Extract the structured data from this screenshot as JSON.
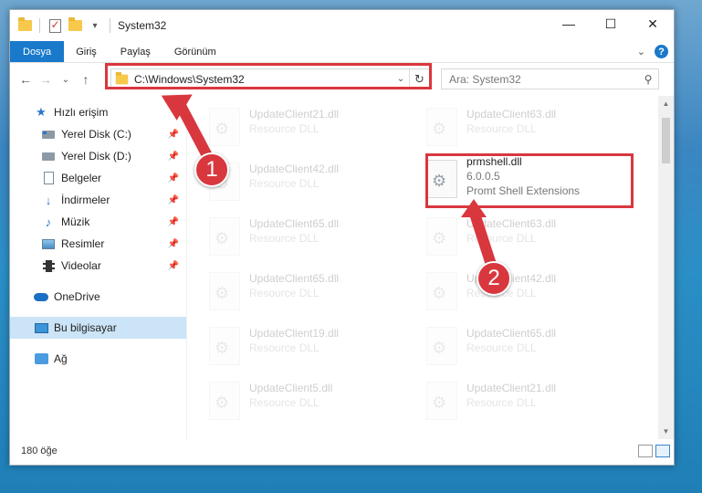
{
  "window": {
    "title": "System32",
    "controls": {
      "minimize": "—",
      "maximize": "☐",
      "close": "✕"
    }
  },
  "ribbon": {
    "tabs": [
      {
        "label": "Dosya",
        "active": true
      },
      {
        "label": "Giriş"
      },
      {
        "label": "Paylaş"
      },
      {
        "label": "Görünüm"
      }
    ],
    "expand_glyph": "⌄",
    "help_glyph": "?"
  },
  "nav": {
    "back": "←",
    "forward": "→",
    "recent": "⌄",
    "up": "↑",
    "address": "C:\\Windows\\System32",
    "address_dropdown": "⌄",
    "refresh": "↻",
    "search_placeholder": "Ara: System32",
    "search_glyph": "⚲"
  },
  "sidebar": {
    "items": [
      {
        "label": "Hızlı erişim",
        "icon": "star-icon"
      },
      {
        "label": "Yerel Disk (C:)",
        "icon": "drive-c-icon",
        "pinned": true
      },
      {
        "label": "Yerel Disk (D:)",
        "icon": "drive-d-icon",
        "pinned": true
      },
      {
        "label": "Belgeler",
        "icon": "documents-icon",
        "pinned": true
      },
      {
        "label": "İndirmeler",
        "icon": "downloads-icon",
        "pinned": true
      },
      {
        "label": "Müzik",
        "icon": "music-icon",
        "pinned": true
      },
      {
        "label": "Resimler",
        "icon": "pictures-icon",
        "pinned": true
      },
      {
        "label": "Videolar",
        "icon": "videos-icon",
        "pinned": true
      },
      {
        "label": "OneDrive",
        "icon": "onedrive-icon"
      },
      {
        "label": "Bu bilgisayar",
        "icon": "this-pc-icon",
        "selected": true
      },
      {
        "label": "Ağ",
        "icon": "network-icon"
      }
    ],
    "pin_glyph": "📌"
  },
  "files": {
    "left_column": [
      {
        "name": "UpdateClient21.dll",
        "type": "Resource DLL"
      },
      {
        "name": "UpdateClient42.dll",
        "type": "Resource DLL"
      },
      {
        "name": "UpdateClient65.dll",
        "type": "Resource DLL"
      },
      {
        "name": "UpdateClient65.dll",
        "type": "Resource DLL"
      },
      {
        "name": "UpdateClient19.dll",
        "type": "Resource DLL"
      },
      {
        "name": "UpdateClient5.dll",
        "type": "Resource DLL"
      }
    ],
    "right_column": [
      {
        "name": "UpdateClient63.dll",
        "type": "Resource DLL"
      },
      {
        "name": "prmshell.dll",
        "version": "6.0.0.5",
        "type": "Promt Shell Extensions",
        "highlighted": true
      },
      {
        "name": "UpdateClient63.dll",
        "type": "Resource DLL"
      },
      {
        "name": "UpdateClient42.dll",
        "type": "Resource DLL"
      },
      {
        "name": "UpdateClient65.dll",
        "type": "Resource DLL"
      },
      {
        "name": "UpdateClient21.dll",
        "type": "Resource DLL"
      }
    ]
  },
  "status": {
    "item_count": "180 öğe"
  },
  "annotations": {
    "step1": "1",
    "step2": "2",
    "color": "#d9373e"
  }
}
